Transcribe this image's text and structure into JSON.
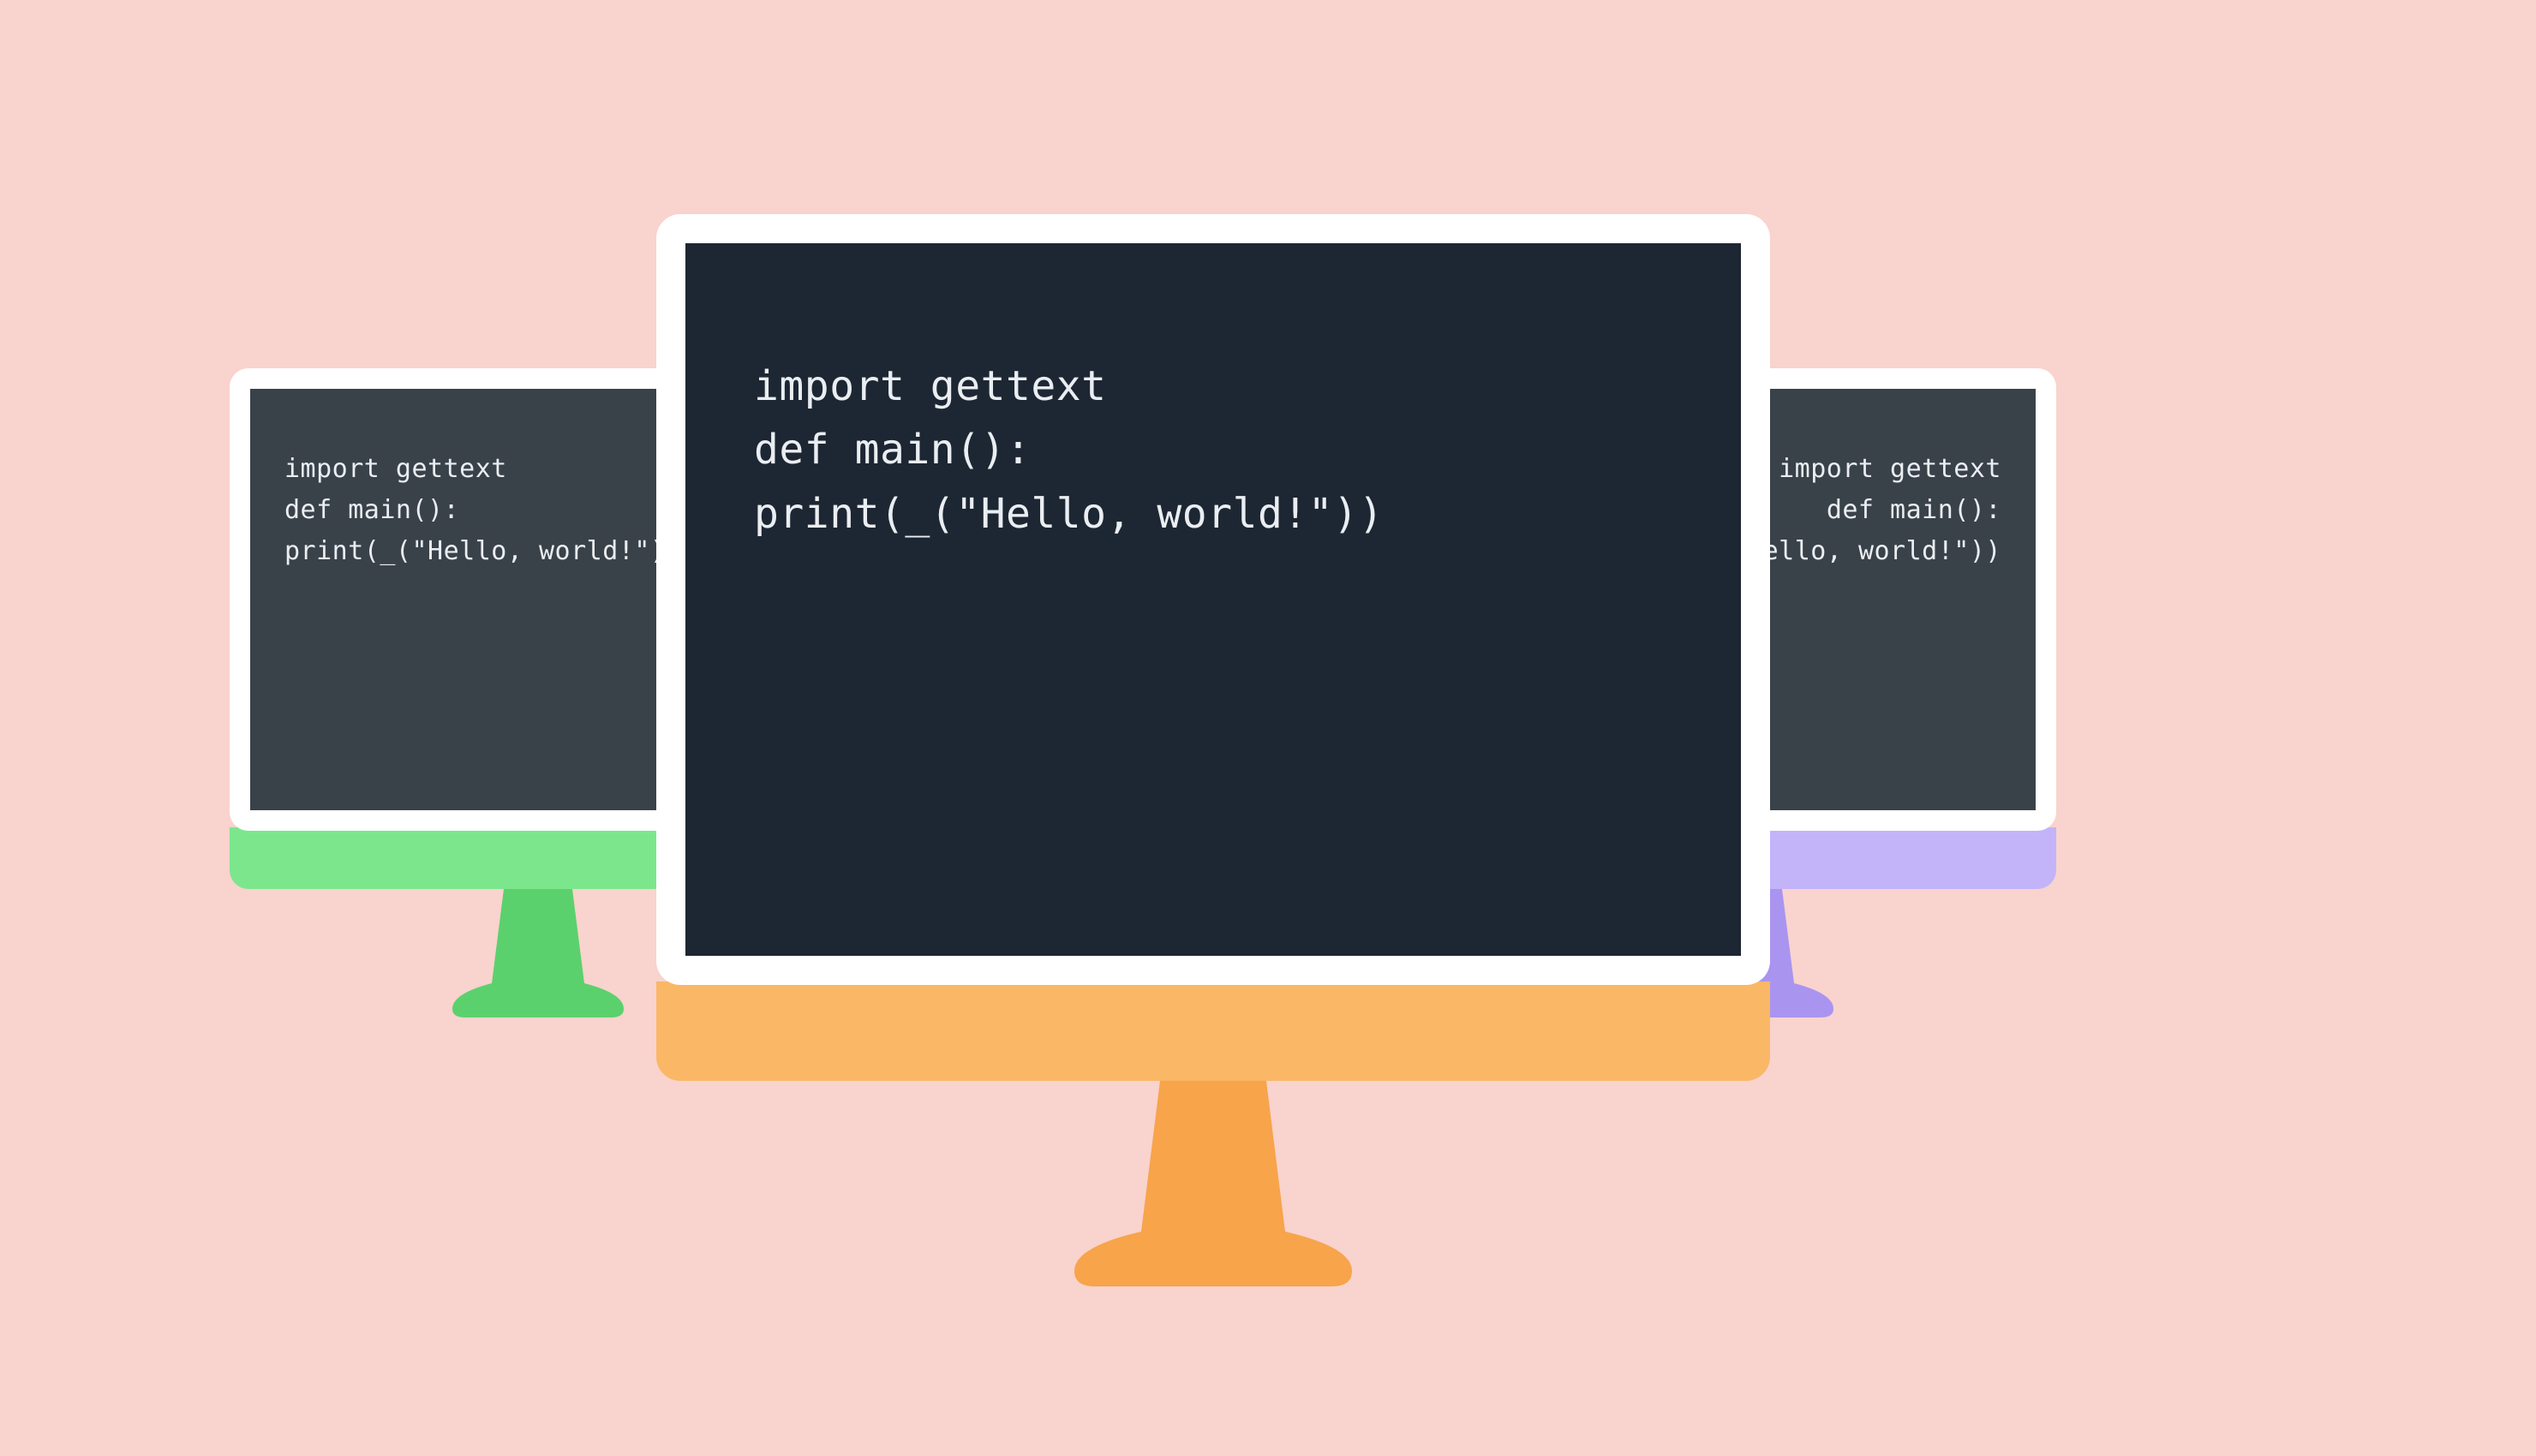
{
  "background_color": "#f9d3cd",
  "monitors": {
    "left": {
      "color_name": "green",
      "chin_color": "#7ce68d",
      "stand_color": "#5bd16d",
      "screen_bg": "#3a4249",
      "code_lines": [
        "import gettext",
        "def main():",
        "print(_(\"Hello, world!\"))"
      ],
      "code_text": "import gettext\ndef main():\nprint(_(\"Hello, world!\"))"
    },
    "right": {
      "color_name": "purple",
      "chin_color": "#c3b4f9",
      "stand_color": "#a995f0",
      "screen_bg": "#3a4249",
      "code_lines": [
        "import gettext",
        "def main():",
        "print(_(\"Hello, world!\"))"
      ],
      "code_text": "import gettext\ndef main():\nprint(_(\"Hello, world!\"))"
    },
    "center": {
      "color_name": "orange",
      "chin_color": "#fab766",
      "stand_color": "#f7a44b",
      "screen_bg": "#1d2733",
      "code_lines": [
        "import gettext",
        "def main():",
        "print(_(\"Hello, world!\"))"
      ],
      "code_text": "import gettext\ndef main():\nprint(_(\"Hello, world!\"))"
    }
  }
}
